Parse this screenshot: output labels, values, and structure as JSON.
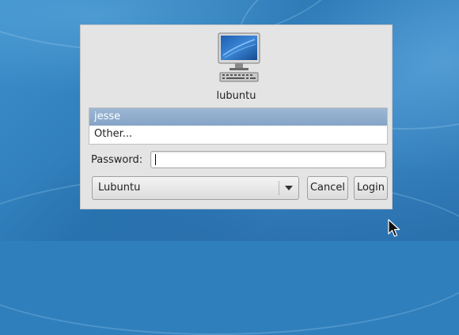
{
  "greeter": {
    "hostname": "lubuntu",
    "users": [
      {
        "label": "jesse",
        "selected": true
      },
      {
        "label": "Other...",
        "selected": false
      }
    ],
    "password_label": "Password:",
    "password_value": "",
    "session": {
      "selected": "Lubuntu"
    },
    "cancel_label": "Cancel",
    "login_label": "Login"
  },
  "icons": {
    "host": "computer-monitor-icon",
    "cursor": "mouse-pointer-icon"
  },
  "colors": {
    "desktop": "#2f7fbd",
    "dialog": "#e4e4e4",
    "selected_row": "#8fadcd"
  }
}
